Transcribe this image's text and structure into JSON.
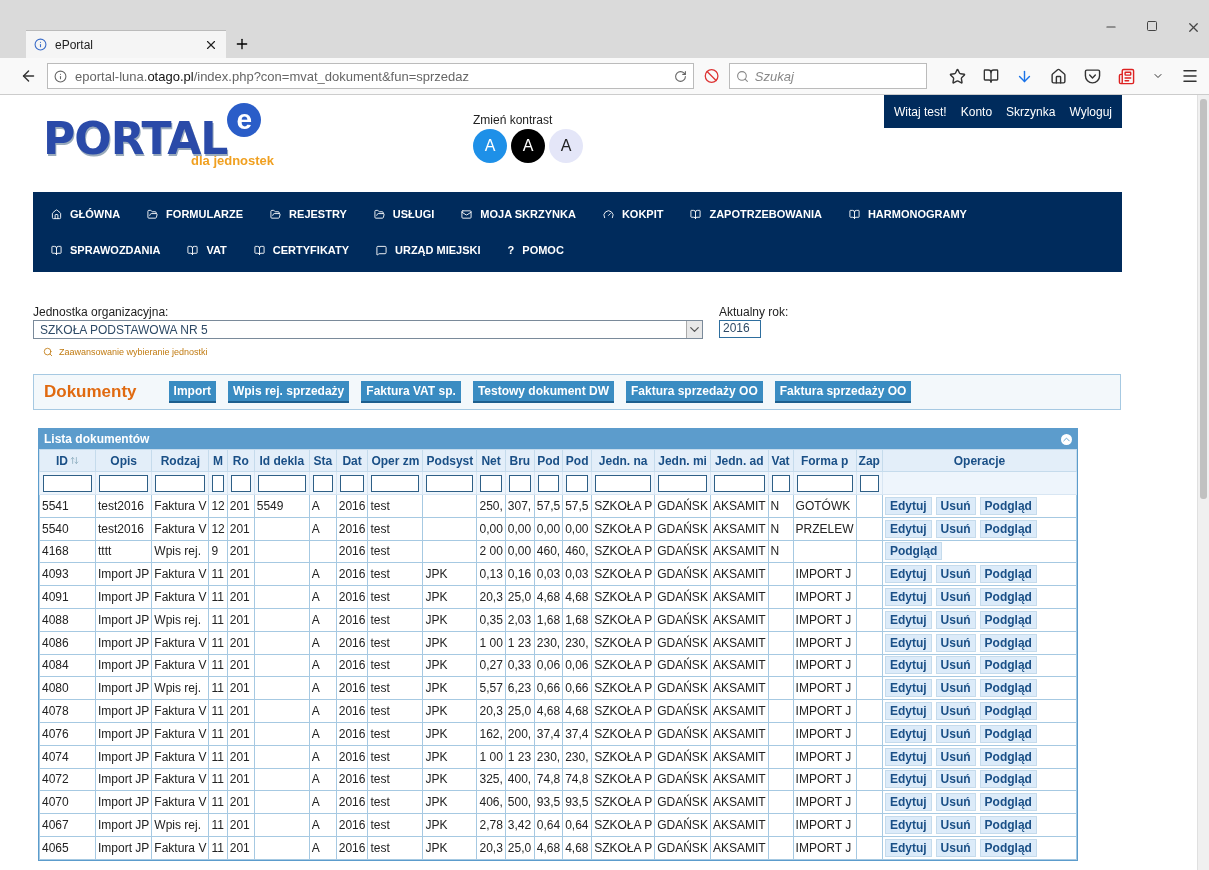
{
  "browser": {
    "tab_title": "ePortal",
    "url": "eportal-luna.**otago.pl**/index.php?con=mvat_dokument&fun=sprzedaz",
    "search_placeholder": "Szukaj"
  },
  "logo": {
    "name": "PORTAL",
    "letter": "e",
    "tagline": "dla jednostek"
  },
  "contrast": {
    "label": "Zmień kontrast",
    "options": [
      {
        "label": "A",
        "kind": "blue"
      },
      {
        "label": "A",
        "kind": "black"
      },
      {
        "label": "A",
        "kind": "light"
      }
    ]
  },
  "user_menu": [
    "Witaj test!",
    "Konto",
    "Skrzynka",
    "Wyloguj"
  ],
  "nav": [
    {
      "label": "GŁÓWNA",
      "kind": "home"
    },
    {
      "label": "FORMULARZE",
      "kind": "folder"
    },
    {
      "label": "REJESTRY",
      "kind": "folder"
    },
    {
      "label": "USŁUGI",
      "kind": "folder"
    },
    {
      "label": "MOJA SKRZYNKA",
      "kind": "mail"
    },
    {
      "label": "KOKPIT",
      "kind": "gauge"
    },
    {
      "label": "ZAPOTRZEBOWANIA",
      "kind": "book"
    },
    {
      "label": "HARMONOGRAMY",
      "kind": "book"
    },
    {
      "label": "SPRAWOZDANIA",
      "kind": "book"
    },
    {
      "label": "VAT",
      "kind": "book"
    },
    {
      "label": "CERTYFIKATY",
      "kind": "book"
    },
    {
      "label": "URZĄD MIEJSKI",
      "kind": "chat"
    },
    {
      "label": "POMOC",
      "kind": "glyph",
      "glyph": "?"
    }
  ],
  "form": {
    "unit_label": "Jednostka organizacyjna:",
    "unit_value": "SZKOŁA PODSTAWOWA NR 5",
    "year_label": "Aktualny rok:",
    "year_value": "2016",
    "advanced_link": "Zaawansowanie wybieranie jednostki"
  },
  "toolbar": {
    "title": "Dokumenty",
    "buttons": [
      "Import",
      "Wpis rej. sprzedaży",
      "Faktura VAT sp.",
      "Testowy dokument DW",
      "Faktura sprzedaży OO",
      "Faktura sprzedaży OO"
    ]
  },
  "grid": {
    "title": "Lista dokumentów",
    "columns": [
      {
        "label": "ID",
        "kind": "data",
        "sorted": true
      },
      {
        "label": "Opis",
        "kind": "data",
        "sorted": false
      },
      {
        "label": "Rodzaj",
        "kind": "data",
        "sorted": false
      },
      {
        "label": "M",
        "kind": "data",
        "sorted": false
      },
      {
        "label": "Ro",
        "kind": "data",
        "sorted": false
      },
      {
        "label": "Id dekla",
        "kind": "data",
        "sorted": false
      },
      {
        "label": "Sta",
        "kind": "data",
        "sorted": false
      },
      {
        "label": "Dat",
        "kind": "data",
        "sorted": false
      },
      {
        "label": "Oper zm",
        "kind": "data",
        "sorted": false
      },
      {
        "label": "Podsyst",
        "kind": "data",
        "sorted": false
      },
      {
        "label": "Net",
        "kind": "data",
        "sorted": false
      },
      {
        "label": "Bru",
        "kind": "data",
        "sorted": false
      },
      {
        "label": "Pod",
        "kind": "data",
        "sorted": false
      },
      {
        "label": "Pod",
        "kind": "data",
        "sorted": false
      },
      {
        "label": "Jedn. na",
        "kind": "data",
        "sorted": false
      },
      {
        "label": "Jedn. mi",
        "kind": "data",
        "sorted": false
      },
      {
        "label": "Jedn. ad",
        "kind": "data",
        "sorted": false
      },
      {
        "label": "Vat",
        "kind": "data",
        "sorted": false
      },
      {
        "label": "Forma p",
        "kind": "data",
        "sorted": false
      },
      {
        "label": "Zap",
        "kind": "data",
        "sorted": false
      },
      {
        "label": "Operacje",
        "kind": "actions",
        "sorted": false
      }
    ],
    "rows": [
      {
        "cells": [
          "5541",
          "test2016",
          "Faktura V",
          "12",
          "201",
          "5549",
          "A",
          "2016",
          "test",
          "",
          "250,",
          "307,",
          "57,5",
          "57,5",
          "SZKOŁA P",
          "GDAŃSK",
          "AKSAMIT",
          "N",
          "GOTÓWK",
          ""
        ],
        "actions": [
          "Edytuj",
          "Usuń",
          "Podgląd"
        ]
      },
      {
        "cells": [
          "5540",
          "test2016",
          "Faktura V",
          "12",
          "201",
          "",
          "A",
          "2016",
          "test",
          "",
          "0,00",
          "0,00",
          "0,00",
          "0,00",
          "SZKOŁA P",
          "GDAŃSK",
          "AKSAMIT",
          "N",
          "PRZELEW",
          ""
        ],
        "actions": [
          "Edytuj",
          "Usuń",
          "Podgląd"
        ]
      },
      {
        "cells": [
          "4168",
          "tttt",
          "Wpis rej.",
          "9",
          "201",
          "",
          "",
          "2016",
          "test",
          "",
          "2 00",
          "0,00",
          "460,",
          "460,",
          "SZKOŁA P",
          "GDAŃSK",
          "AKSAMIT",
          "N",
          "",
          ""
        ],
        "actions": [
          "Podgląd"
        ]
      },
      {
        "cells": [
          "4093",
          "Import JP",
          "Faktura V",
          "11",
          "201",
          "",
          "A",
          "2016",
          "test",
          "JPK",
          "0,13",
          "0,16",
          "0,03",
          "0,03",
          "SZKOŁA P",
          "GDAŃSK",
          "AKSAMIT",
          "",
          "IMPORT J",
          ""
        ],
        "actions": [
          "Edytuj",
          "Usuń",
          "Podgląd"
        ]
      },
      {
        "cells": [
          "4091",
          "Import JP",
          "Faktura V",
          "11",
          "201",
          "",
          "A",
          "2016",
          "test",
          "JPK",
          "20,3",
          "25,0",
          "4,68",
          "4,68",
          "SZKOŁA P",
          "GDAŃSK",
          "AKSAMIT",
          "",
          "IMPORT J",
          ""
        ],
        "actions": [
          "Edytuj",
          "Usuń",
          "Podgląd"
        ]
      },
      {
        "cells": [
          "4088",
          "Import JP",
          "Wpis rej.",
          "11",
          "201",
          "",
          "A",
          "2016",
          "test",
          "JPK",
          "0,35",
          "2,03",
          "1,68",
          "1,68",
          "SZKOŁA P",
          "GDAŃSK",
          "AKSAMIT",
          "",
          "IMPORT J",
          ""
        ],
        "actions": [
          "Edytuj",
          "Usuń",
          "Podgląd"
        ]
      },
      {
        "cells": [
          "4086",
          "Import JP",
          "Faktura V",
          "11",
          "201",
          "",
          "A",
          "2016",
          "test",
          "JPK",
          "1 00",
          "1 23",
          "230,",
          "230,",
          "SZKOŁA P",
          "GDAŃSK",
          "AKSAMIT",
          "",
          "IMPORT J",
          ""
        ],
        "actions": [
          "Edytuj",
          "Usuń",
          "Podgląd"
        ]
      },
      {
        "cells": [
          "4084",
          "Import JP",
          "Faktura V",
          "11",
          "201",
          "",
          "A",
          "2016",
          "test",
          "JPK",
          "0,27",
          "0,33",
          "0,06",
          "0,06",
          "SZKOŁA P",
          "GDAŃSK",
          "AKSAMIT",
          "",
          "IMPORT J",
          ""
        ],
        "actions": [
          "Edytuj",
          "Usuń",
          "Podgląd"
        ]
      },
      {
        "cells": [
          "4080",
          "Import JP",
          "Wpis rej.",
          "11",
          "201",
          "",
          "A",
          "2016",
          "test",
          "JPK",
          "5,57",
          "6,23",
          "0,66",
          "0,66",
          "SZKOŁA P",
          "GDAŃSK",
          "AKSAMIT",
          "",
          "IMPORT J",
          ""
        ],
        "actions": [
          "Edytuj",
          "Usuń",
          "Podgląd"
        ]
      },
      {
        "cells": [
          "4078",
          "Import JP",
          "Faktura V",
          "11",
          "201",
          "",
          "A",
          "2016",
          "test",
          "JPK",
          "20,3",
          "25,0",
          "4,68",
          "4,68",
          "SZKOŁA P",
          "GDAŃSK",
          "AKSAMIT",
          "",
          "IMPORT J",
          ""
        ],
        "actions": [
          "Edytuj",
          "Usuń",
          "Podgląd"
        ]
      },
      {
        "cells": [
          "4076",
          "Import JP",
          "Faktura V",
          "11",
          "201",
          "",
          "A",
          "2016",
          "test",
          "JPK",
          "162,",
          "200,",
          "37,4",
          "37,4",
          "SZKOŁA P",
          "GDAŃSK",
          "AKSAMIT",
          "",
          "IMPORT J",
          ""
        ],
        "actions": [
          "Edytuj",
          "Usuń",
          "Podgląd"
        ]
      },
      {
        "cells": [
          "4074",
          "Import JP",
          "Faktura V",
          "11",
          "201",
          "",
          "A",
          "2016",
          "test",
          "JPK",
          "1 00",
          "1 23",
          "230,",
          "230,",
          "SZKOŁA P",
          "GDAŃSK",
          "AKSAMIT",
          "",
          "IMPORT J",
          ""
        ],
        "actions": [
          "Edytuj",
          "Usuń",
          "Podgląd"
        ]
      },
      {
        "cells": [
          "4072",
          "Import JP",
          "Faktura V",
          "11",
          "201",
          "",
          "A",
          "2016",
          "test",
          "JPK",
          "325,",
          "400,",
          "74,8",
          "74,8",
          "SZKOŁA P",
          "GDAŃSK",
          "AKSAMIT",
          "",
          "IMPORT J",
          ""
        ],
        "actions": [
          "Edytuj",
          "Usuń",
          "Podgląd"
        ]
      },
      {
        "cells": [
          "4070",
          "Import JP",
          "Faktura V",
          "11",
          "201",
          "",
          "A",
          "2016",
          "test",
          "JPK",
          "406,",
          "500,",
          "93,5",
          "93,5",
          "SZKOŁA P",
          "GDAŃSK",
          "AKSAMIT",
          "",
          "IMPORT J",
          ""
        ],
        "actions": [
          "Edytuj",
          "Usuń",
          "Podgląd"
        ]
      },
      {
        "cells": [
          "4067",
          "Import JP",
          "Wpis rej.",
          "11",
          "201",
          "",
          "A",
          "2016",
          "test",
          "JPK",
          "2,78",
          "3,42",
          "0,64",
          "0,64",
          "SZKOŁA P",
          "GDAŃSK",
          "AKSAMIT",
          "",
          "IMPORT J",
          ""
        ],
        "actions": [
          "Edytuj",
          "Usuń",
          "Podgląd"
        ]
      },
      {
        "cells": [
          "4065",
          "Import JP",
          "Faktura V",
          "11",
          "201",
          "",
          "A",
          "2016",
          "test",
          "JPK",
          "20,3",
          "25,0",
          "4,68",
          "4,68",
          "SZKOŁA P",
          "GDAŃSK",
          "AKSAMIT",
          "",
          "IMPORT J",
          ""
        ],
        "actions": [
          "Edytuj",
          "Usuń",
          "Podgląd"
        ]
      }
    ]
  }
}
